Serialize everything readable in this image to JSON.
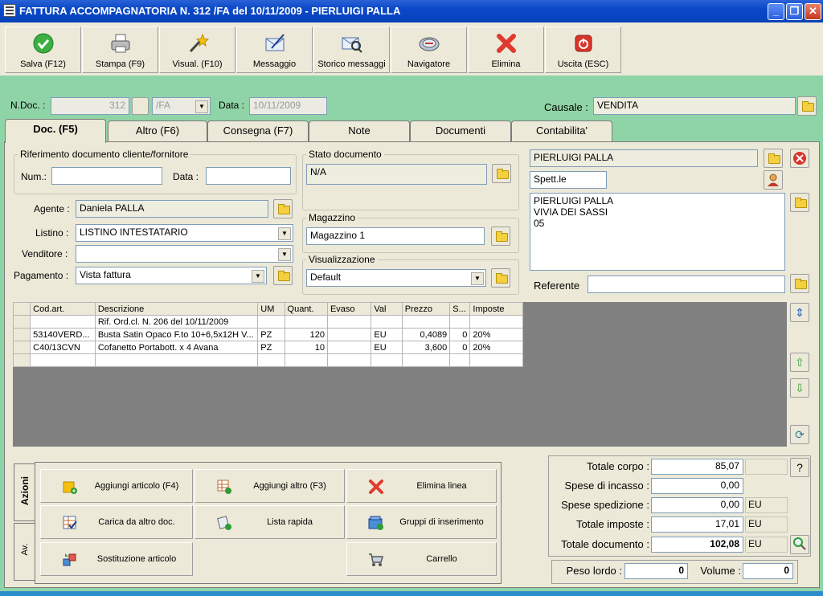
{
  "window": {
    "title": "FATTURA ACCOMPAGNATORIA N. 312 /FA del 10/11/2009 - PIERLUIGI PALLA"
  },
  "toolbar": [
    {
      "label": "Salva (F12)",
      "icon": "check-icon"
    },
    {
      "label": "Stampa (F9)",
      "icon": "printer-icon"
    },
    {
      "label": "Visual. (F10)",
      "icon": "magic-wand-icon"
    },
    {
      "label": "Messaggio",
      "icon": "envelope-pen-icon"
    },
    {
      "label": "Storico messaggi",
      "icon": "envelope-search-icon"
    },
    {
      "label": "Navigatore",
      "icon": "compass-icon"
    },
    {
      "label": "Elimina",
      "icon": "red-x-icon"
    },
    {
      "label": "Uscita (ESC)",
      "icon": "power-icon"
    }
  ],
  "header": {
    "ndoc_label": "N.Doc. :",
    "ndoc_value": "312",
    "series_value": "/FA",
    "data_label": "Data :",
    "data_value": "10/11/2009",
    "causale_label": "Causale :",
    "causale_value": "VENDITA"
  },
  "tabs": [
    "Doc. (F5)",
    "Altro (F6)",
    "Consegna (F7)",
    "Note",
    "Documenti",
    "Contabilita'"
  ],
  "rif": {
    "title": "Riferimento documento cliente/fornitore",
    "num_label": "Num.:",
    "num_value": "",
    "data_label": "Data :",
    "data_value": ""
  },
  "agente": {
    "label": "Agente :",
    "value": "Daniela PALLA"
  },
  "listino": {
    "label": "Listino :",
    "value": "LISTINO INTESTATARIO"
  },
  "venditore": {
    "label": "Venditore :",
    "value": ""
  },
  "pagamento": {
    "label": "Pagamento :",
    "value": "Vista fattura"
  },
  "stato": {
    "title": "Stato documento",
    "value": "N/A"
  },
  "magazzino": {
    "title": "Magazzino",
    "value": "Magazzino 1"
  },
  "visualizzazione": {
    "title": "Visualizzazione",
    "value": "Default"
  },
  "cliente": {
    "name": "PIERLUIGI PALLA",
    "salutation": "Spett.le",
    "address_lines": [
      "PIERLUIGI PALLA",
      "VIVIA DEI SASSI",
      "05"
    ],
    "referente_label": "Referente",
    "referente_value": ""
  },
  "grid": {
    "columns": [
      "Cod.art.",
      "Descrizione",
      "UM",
      "Quant.",
      "Evaso",
      "Val",
      "Prezzo",
      "S...",
      "Imposte"
    ],
    "rows": [
      [
        "",
        "Rif. Ord.cl. N. 206 del 10/11/2009",
        "",
        "",
        "",
        "",
        "",
        "",
        ""
      ],
      [
        "53140VERD...",
        "Busta Satin Opaco F.to 10+6,5x12H V...",
        "PZ",
        "120",
        "",
        "EU",
        "0,4089",
        "0",
        "20%"
      ],
      [
        "C40/13CVN",
        "Cofanetto Portabott. x 4 Avana",
        "PZ",
        "10",
        "",
        "EU",
        "3,600",
        "0",
        "20%"
      ],
      [
        "",
        "",
        "",
        "",
        "",
        "",
        "",
        "",
        ""
      ]
    ]
  },
  "side_tabs": [
    "Azioni",
    "Av."
  ],
  "actions": [
    {
      "label": "Aggiungi articolo (F4)",
      "icon": "box-add-icon"
    },
    {
      "label": "Aggiungi altro (F3)",
      "icon": "grid-add-icon"
    },
    {
      "label": "Elimina linea",
      "icon": "red-x-icon"
    },
    {
      "label": "Carica da altro doc.",
      "icon": "checklist-icon"
    },
    {
      "label": "Lista rapida",
      "icon": "list-add-icon"
    },
    {
      "label": "Gruppi di inserimento",
      "icon": "group-add-icon"
    },
    {
      "label": "Sostituzione articolo",
      "icon": "swap-icon"
    },
    {
      "label": "Carrello",
      "icon": "cart-icon"
    }
  ],
  "totals": {
    "corpo_label": "Totale corpo :",
    "corpo_value": "85,07",
    "incasso_label": "Spese di incasso :",
    "incasso_value": "0,00",
    "spedizione_label": "Spese spedizione :",
    "spedizione_value": "0,00",
    "spedizione_unit": "EU",
    "imposte_label": "Totale imposte :",
    "imposte_value": "17,01",
    "imposte_unit": "EU",
    "documento_label": "Totale documento :",
    "documento_value": "102,08",
    "documento_unit": "EU",
    "help": "?"
  },
  "peso": {
    "label": "Peso lordo :",
    "value": "0",
    "volume_label": "Volume :",
    "volume_value": "0"
  }
}
